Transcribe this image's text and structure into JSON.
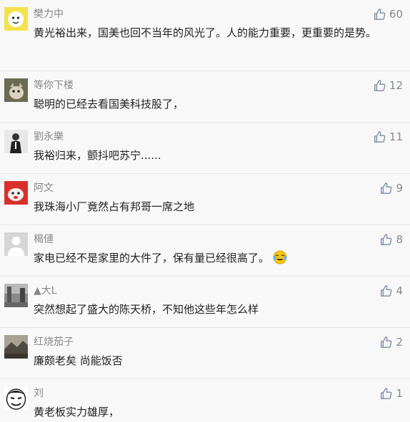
{
  "comments": [
    {
      "name": "樊力中",
      "text": "黄光裕出来，国美也回不当年的风光了。人的能力重要，更重要的是势。",
      "likes": "60",
      "avatar": "cartoon-avatar"
    },
    {
      "name": "等你下楼",
      "text": "聪明的已经去看国美科技股了，",
      "likes": "12",
      "avatar": "pet-avatar"
    },
    {
      "name": "劉永樂",
      "text": "我裕归来，颤抖吧苏宁......",
      "likes": "11",
      "avatar": "person-avatar"
    },
    {
      "name": "阿文",
      "text": "我珠海小厂竟然占有邦哥一席之地",
      "likes": "9",
      "avatar": "red-avatar"
    },
    {
      "name": "楬僆",
      "text": "家电已经不是家里的大件了，保有量已经很高了。",
      "likes": "8",
      "avatar": "default-avatar",
      "emoji": "crying-laughing-emoji"
    },
    {
      "name": "▲大L",
      "text": "突然想起了盛大的陈天桥，不知他这些年怎么样",
      "likes": "4",
      "avatar": "street-avatar"
    },
    {
      "name": "红烧茄子",
      "text": "廉颇老矣 尚能饭否",
      "likes": "2",
      "avatar": "landscape-avatar"
    },
    {
      "name": "刘",
      "text": "黄老板实力雄厚，",
      "likes": "1",
      "avatar": "meme-avatar"
    }
  ]
}
